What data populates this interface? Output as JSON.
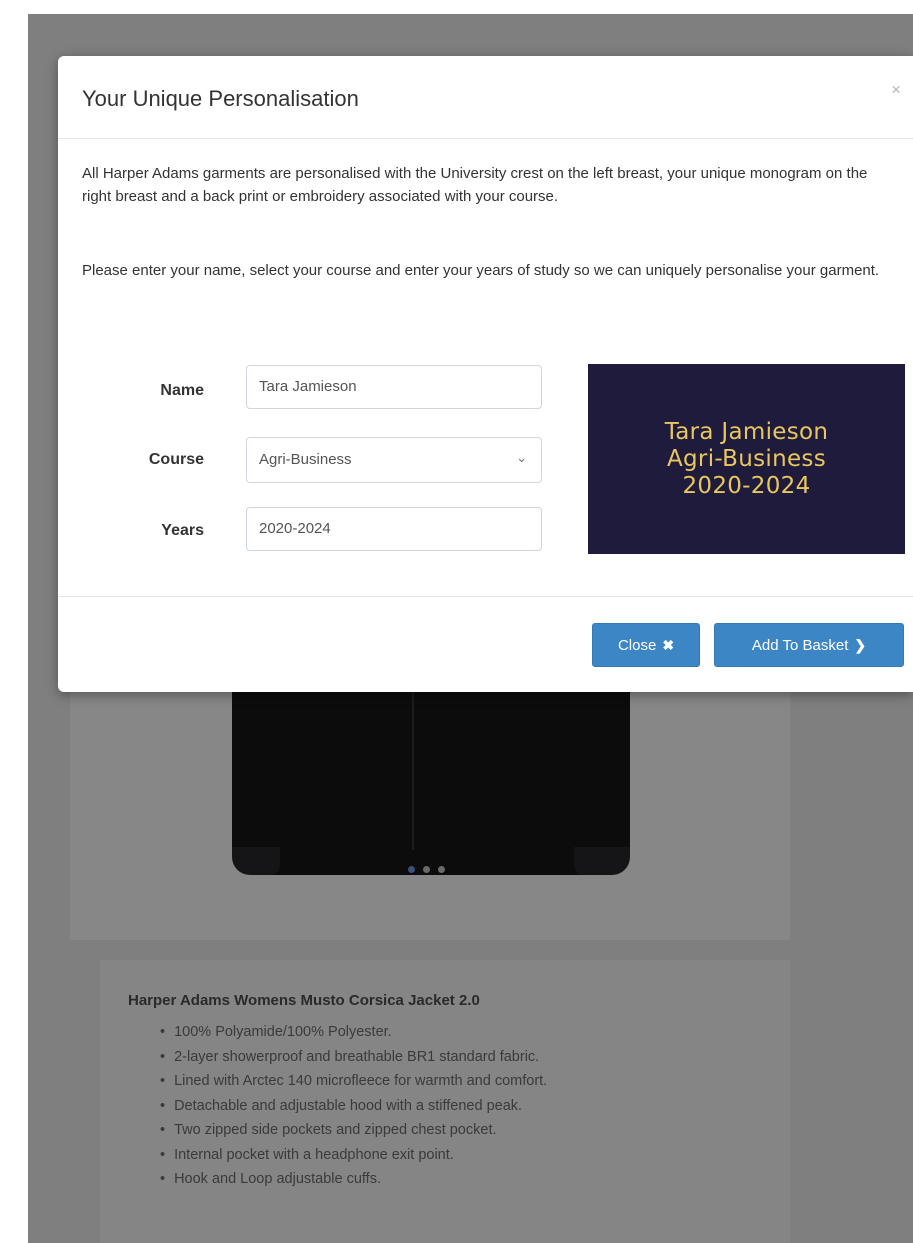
{
  "modal": {
    "title": "Your Unique Personalisation",
    "close_x": "×",
    "intro": "All Harper Adams garments are personalised with the University crest on the left breast, your unique monogram on the right breast and a back print or embroidery associated with your course.",
    "instructions": "Please enter your name, select your course and enter your years of study so we can uniquely personalise your garment.",
    "form": {
      "name_label": "Name",
      "name_value": "Tara Jamieson",
      "course_label": "Course",
      "course_value": "Agri-Business",
      "years_label": "Years",
      "years_value": "2020-2024"
    },
    "preview": {
      "line1": "Tara Jamieson",
      "line2": "Agri-Business",
      "line3": "2020-2024",
      "text_color": "#e9c75e",
      "background_color": "#1f1b3d"
    },
    "footer": {
      "close_label": "Close",
      "close_glyph": "✖",
      "add_label": "Add To Basket",
      "add_glyph": "❯",
      "button_color": "#3c86c6"
    }
  },
  "background": {
    "product_title": "Harper Adams Womens Musto Corsica Jacket 2.0",
    "features": [
      "100% Polyamide/100% Polyester.",
      "2-layer showerproof and breathable BR1 standard fabric.",
      "Lined with Arctec 140 microfleece for warmth and comfort.",
      "Detachable and adjustable hood with a stiffened peak.",
      "Two zipped side pockets and zipped chest pocket.",
      "Internal pocket with a headphone exit point.",
      "Hook and Loop adjustable cuffs."
    ]
  }
}
